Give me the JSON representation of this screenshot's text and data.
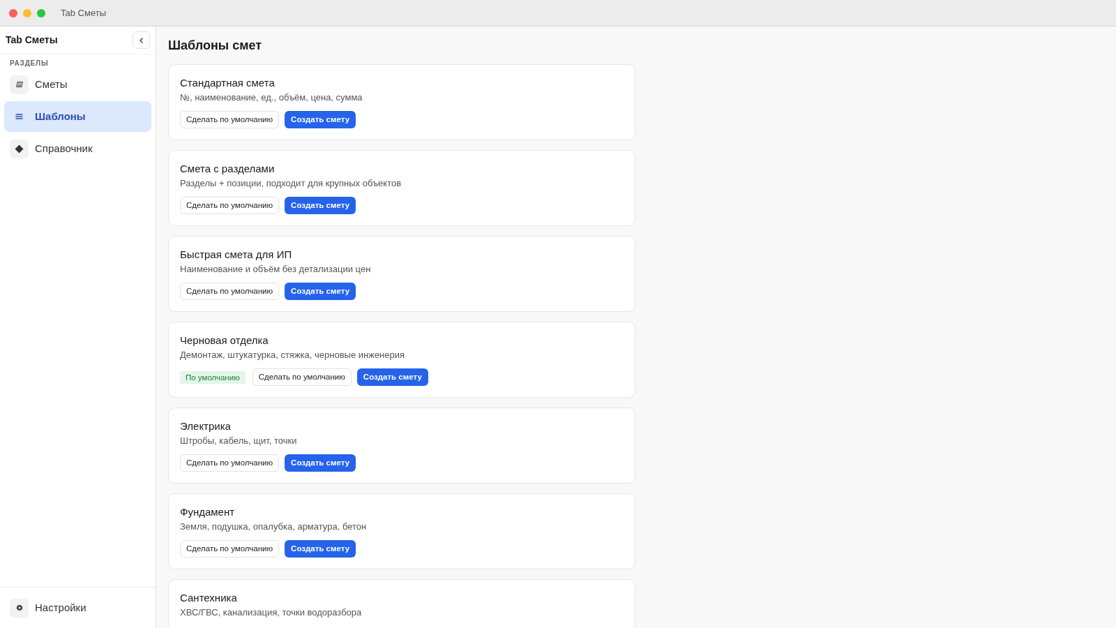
{
  "window": {
    "title": "Tab Сметы"
  },
  "sidebar": {
    "title": "Tab Сметы",
    "section_label": "РАЗДЕЛЫ",
    "items": [
      {
        "label": "Сметы",
        "selected": false
      },
      {
        "label": "Шаблоны",
        "selected": true
      },
      {
        "label": "Справочник",
        "selected": false
      }
    ],
    "footer_item": {
      "label": "Настройки"
    }
  },
  "main": {
    "title": "Шаблоны смет",
    "templates": [
      {
        "name": "Стандартная смета",
        "description": "№, наименование, ед., объём, цена, сумма",
        "actions": [
          {
            "label": "Сделать по умолчанию",
            "kind": "secondary"
          },
          {
            "label": "Создать смету",
            "kind": "primary"
          }
        ]
      },
      {
        "name": "Смета с разделами",
        "description": "Разделы + позиции, подходит для крупных объектов",
        "actions": [
          {
            "label": "Сделать по умолчанию",
            "kind": "secondary"
          },
          {
            "label": "Создать смету",
            "kind": "primary"
          }
        ]
      },
      {
        "name": "Быстрая смета для ИП",
        "description": "Наименование и объём без детализации цен",
        "actions": [
          {
            "label": "Сделать по умолчанию",
            "kind": "secondary"
          },
          {
            "label": "Создать смету",
            "kind": "primary"
          }
        ]
      },
      {
        "name": "Черновая отделка",
        "description": "Демонтаж, штукатурка, стяжка, черновые инженерия",
        "badge": "По умолчанию",
        "actions": [
          {
            "label": "Сделать по умолчанию",
            "kind": "secondary"
          },
          {
            "label": "Создать смету",
            "kind": "primary"
          }
        ]
      },
      {
        "name": "Электрика",
        "description": "Штробы, кабель, щит, точки",
        "actions": [
          {
            "label": "Сделать по умолчанию",
            "kind": "secondary"
          },
          {
            "label": "Создать смету",
            "kind": "primary"
          }
        ]
      },
      {
        "name": "Фундамент",
        "description": "Земля, подушка, опалубка, арматура, бетон",
        "actions": [
          {
            "label": "Сделать по умолчанию",
            "kind": "secondary"
          },
          {
            "label": "Создать смету",
            "kind": "primary"
          }
        ]
      },
      {
        "name": "Сантехника",
        "description": "ХВС/ГВС, канализация, точки водоразбора"
      }
    ]
  }
}
